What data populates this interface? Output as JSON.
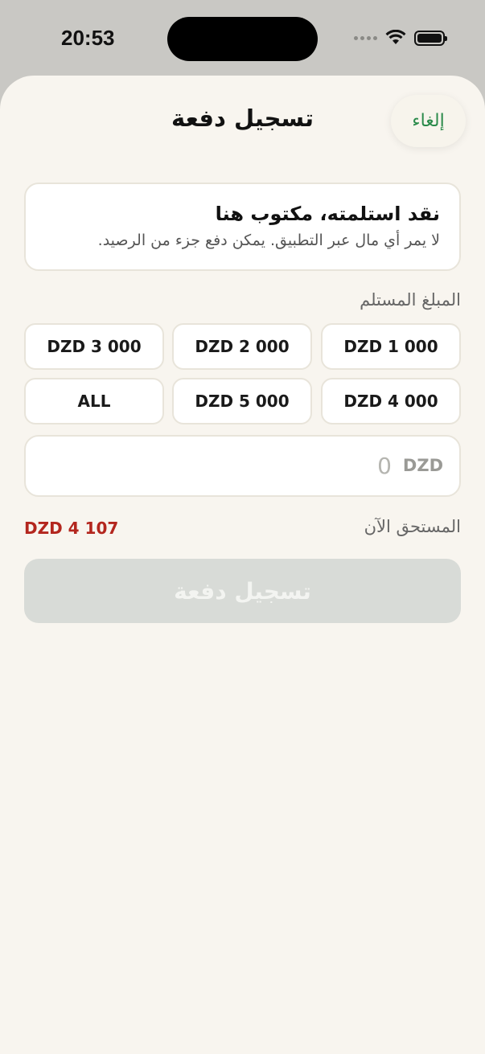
{
  "status_bar": {
    "time": "20:53"
  },
  "header": {
    "title": "تسجيل دفعة",
    "cancel_label": "إلغاء"
  },
  "info_card": {
    "title": "نقد استلمته، مكتوب هنا",
    "subtitle": "لا يمر أي مال عبر التطبيق. يمكن دفع جزء من الرصيد."
  },
  "amount_section": {
    "label": "المبلغ المستلم",
    "presets": [
      "DZD 1 000",
      "DZD 2 000",
      "DZD 3 000",
      "DZD 4 000",
      "DZD 5 000",
      "ALL"
    ],
    "input": {
      "currency": "DZD",
      "placeholder": "0",
      "value": ""
    }
  },
  "due": {
    "label": "المستحق الآن",
    "value": "DZD 4 107"
  },
  "submit_label": "تسجيل دفعة",
  "colors": {
    "accent_green": "#2a8a4a",
    "due_red": "#b3261e",
    "sheet_bg": "#f8f5ef",
    "disabled_button": "#d8dbd7"
  }
}
